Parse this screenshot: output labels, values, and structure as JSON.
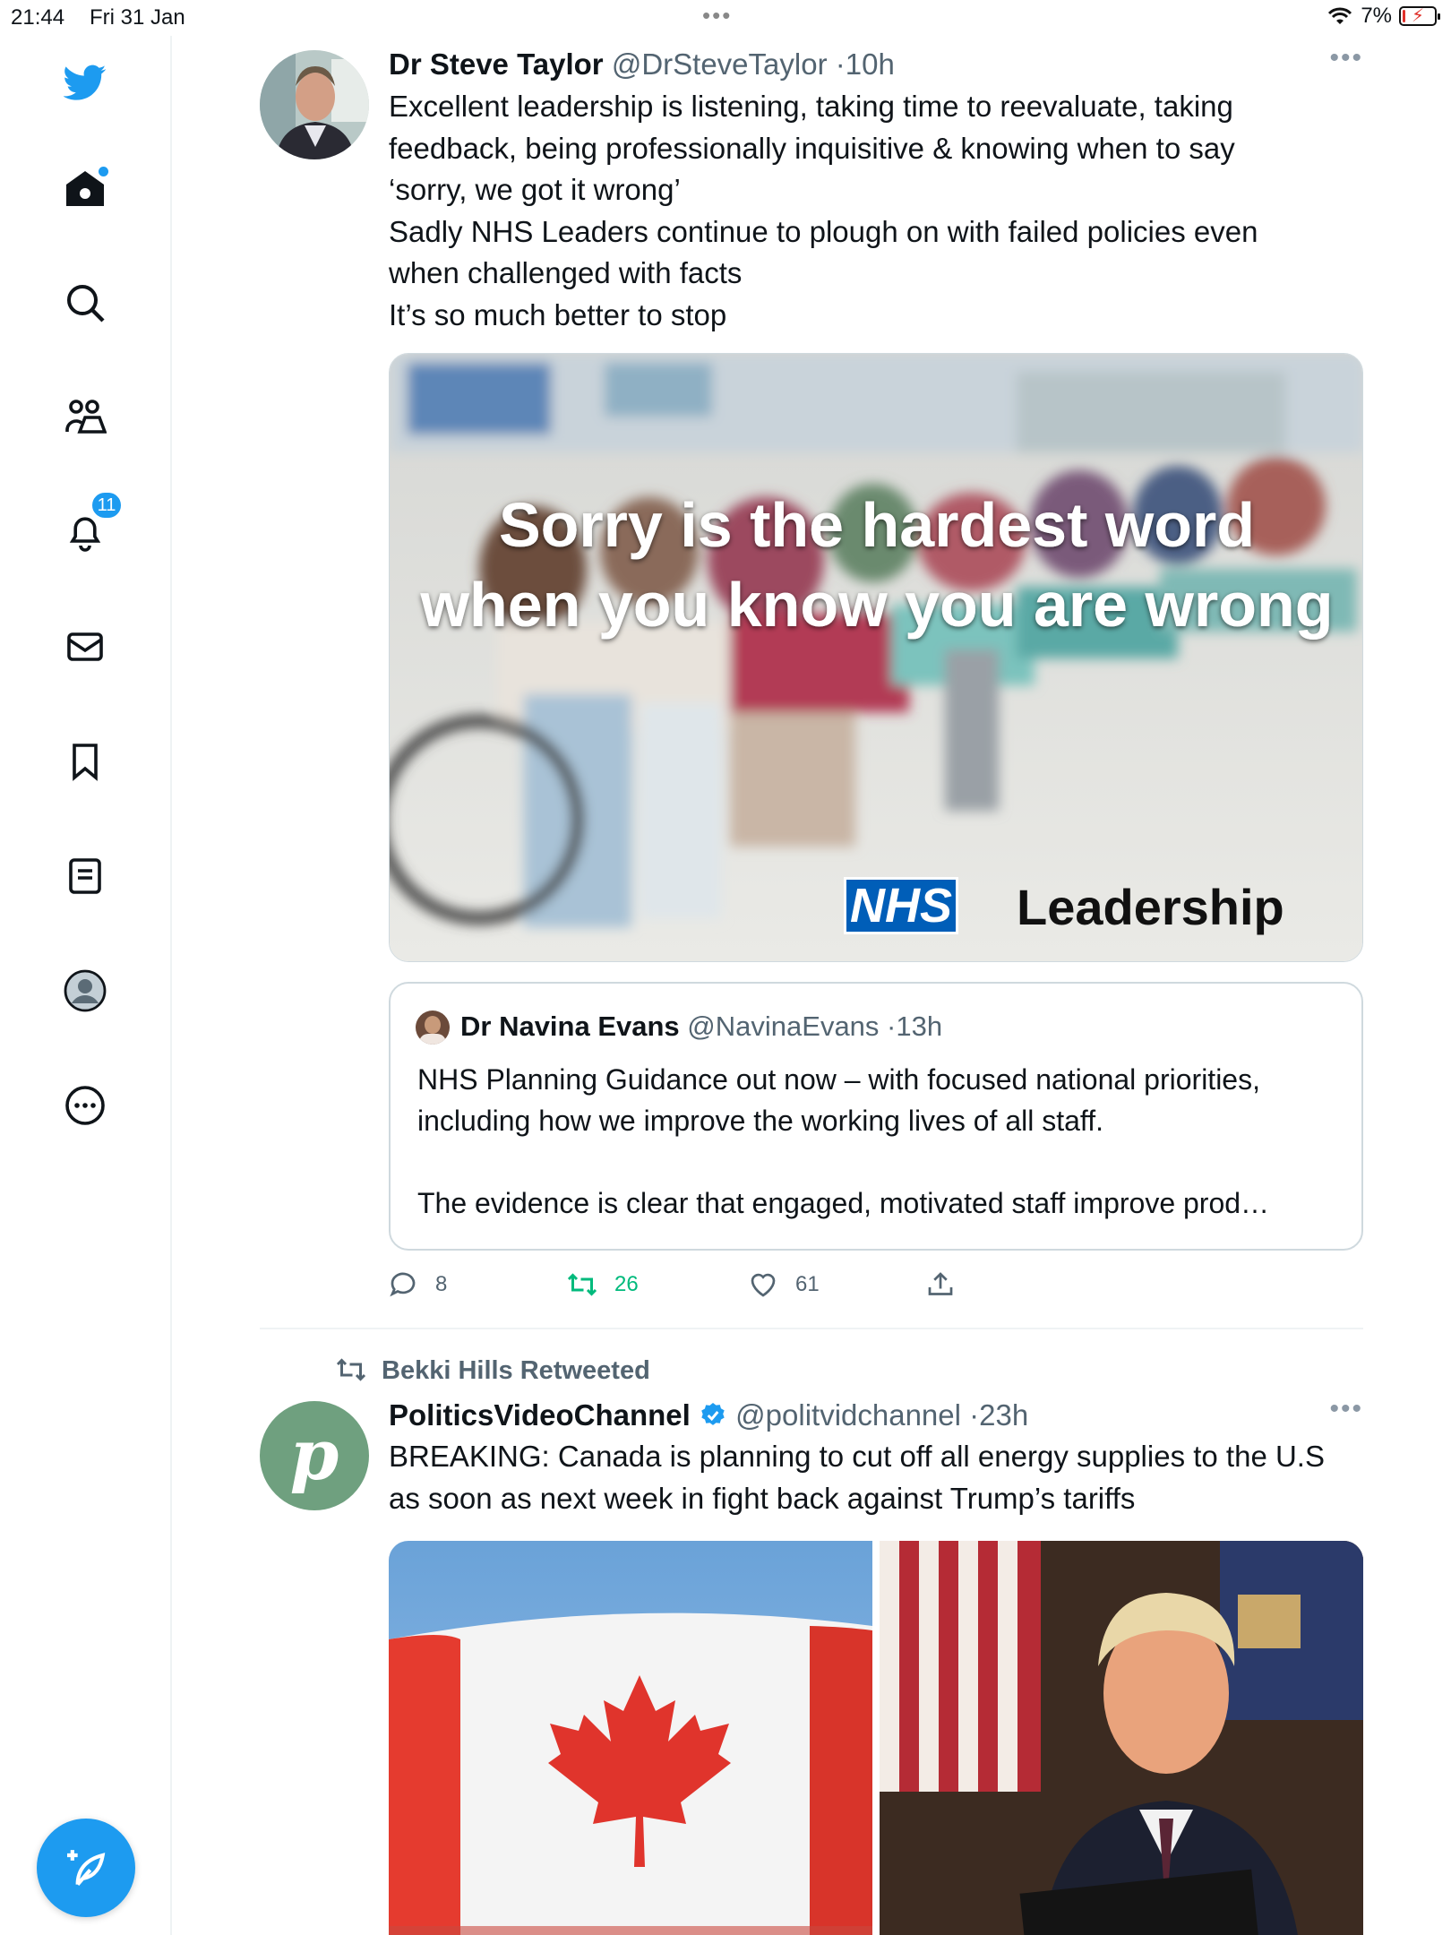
{
  "status_bar": {
    "time": "21:44",
    "date": "Fri 31 Jan",
    "battery": "7%",
    "battery_level": 0.07
  },
  "sidebar": {
    "items": [
      {
        "name": "twitter-logo",
        "icon": "twitter-bird-icon"
      },
      {
        "name": "home",
        "icon": "home-icon",
        "has_dot": true
      },
      {
        "name": "explore",
        "icon": "search-icon"
      },
      {
        "name": "communities",
        "icon": "communities-icon"
      },
      {
        "name": "notifications",
        "icon": "bell-icon",
        "badge": "11"
      },
      {
        "name": "messages",
        "icon": "mail-icon"
      },
      {
        "name": "bookmarks",
        "icon": "bookmark-icon"
      },
      {
        "name": "lists",
        "icon": "list-icon"
      },
      {
        "name": "profile",
        "icon": "profile-avatar-icon"
      },
      {
        "name": "more",
        "icon": "more-circle-icon"
      }
    ],
    "compose_icon": "compose-tweet-icon"
  },
  "tweets": [
    {
      "name": "Dr Steve Taylor",
      "handle": "@DrSteveTaylor",
      "time": "10h",
      "text_lines": [
        "Excellent leadership is listening, taking time to reevaluate, taking",
        "feedback, being professionally inquisitive &  knowing when to say",
        "‘sorry, we got it wrong’",
        "Sadly NHS Leaders continue to plough on with failed policies even",
        "when challenged with facts",
        "It’s so much better to stop"
      ],
      "image": {
        "caption_line1": "Sorry is the hardest word",
        "caption_line2": "when you know you are wrong",
        "logo_nhs": "NHS",
        "logo_word": "Leadership"
      },
      "quoted": {
        "name": "Dr Navina Evans",
        "handle": "@NavinaEvans",
        "time": "13h",
        "text_line1": "NHS Planning Guidance out now – with focused national priorities,",
        "text_line2": "including how we improve the working lives of all staff.",
        "text_line3": "The evidence is clear that engaged, motivated staff improve prod…"
      },
      "stats": {
        "replies": "8",
        "retweets": "26",
        "likes": "61"
      }
    },
    {
      "retweeted_by": "Bekki Hills Retweeted",
      "name": "PoliticsVideoChannel",
      "handle": "@politvidchannel",
      "time": "23h",
      "avatar_letter": "p",
      "text_lines": [
        "BREAKING: Canada is planning to cut off all energy supplies to the U.S",
        "as soon as next week in fight back against Trump’s tariffs"
      ]
    }
  ],
  "colors": {
    "accent": "#1d9bf0",
    "retweet_green": "#00ba7c",
    "secondary_text": "#536471"
  }
}
